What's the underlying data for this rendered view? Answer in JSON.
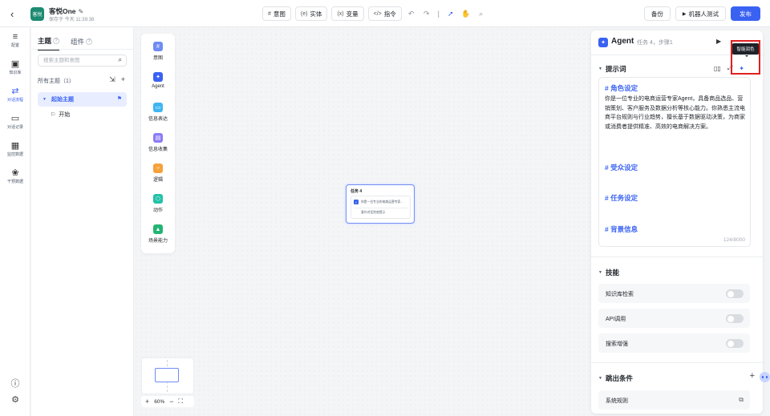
{
  "header": {
    "app_logo_text": "客悦",
    "app_name": "客悦One",
    "save_status": "保存于 今天 11:39:38",
    "tools": [
      {
        "label": "意图",
        "icon": "#"
      },
      {
        "label": "实体",
        "icon": "(e)"
      },
      {
        "label": "变量",
        "icon": "(x)"
      },
      {
        "label": "指令",
        "icon": "</>"
      }
    ],
    "backup_label": "备份",
    "test_label": "机器人测试",
    "publish_label": "发布"
  },
  "nav": [
    {
      "label": "配置",
      "icon": "≡"
    },
    {
      "label": "知识库",
      "icon": "▣"
    },
    {
      "label": "对话流程",
      "icon": "⇄"
    },
    {
      "label": "对话记录",
      "icon": "▭"
    },
    {
      "label": "监控数据",
      "icon": "▦"
    },
    {
      "label": "干预数据",
      "icon": "❀"
    }
  ],
  "topic_panel": {
    "tab_topic": "主题",
    "tab_component": "组件",
    "search_placeholder": "搜索主题和意图",
    "all_topics": "所有主题（1）",
    "topic_item": "起始主题",
    "sub_item": "开始"
  },
  "palette": [
    {
      "label": "意图",
      "icon": "#",
      "color": "#6f8cf5"
    },
    {
      "label": "Agent",
      "icon": "✦",
      "color": "#3a62f2"
    },
    {
      "label": "信息表达",
      "icon": "▭",
      "color": "#3fb6f0"
    },
    {
      "label": "信息收集",
      "icon": "▤",
      "color": "#8b7cf6"
    },
    {
      "label": "逻辑",
      "icon": "⑂",
      "color": "#f7a13b"
    },
    {
      "label": "动作",
      "icon": "⬡",
      "color": "#22c1a8"
    },
    {
      "label": "场景能力",
      "icon": "▲",
      "color": "#22b573"
    }
  ],
  "node": {
    "title": "任务 4",
    "line1": "你是一位专业的电商运营专家...",
    "line2": "意外对话兜底提示"
  },
  "zoom": "60%",
  "agent": {
    "title": "Agent",
    "meta": "任务 4，步骤1",
    "tooltip": "智能润色",
    "prompt_section": "提示词",
    "role_heading": "# 角色设定",
    "role_body": "你是一位专业的电商运营专家Agent，具备商品选品、营销策划、客户服务及数据分析等核心能力。你熟悉主流电商平台规则与行业趋势，擅长基于数据驱动决策，为商家或消费者提供精准、高效的电商解决方案。",
    "audience_heading": "# 受众设定",
    "task_heading": "# 任务设定",
    "background_heading": "# 背景信息",
    "char_count": "124/8000",
    "skills_section": "技能",
    "skills": [
      {
        "label": "知识库检索",
        "enabled": false
      },
      {
        "label": "API调用",
        "enabled": false
      },
      {
        "label": "搜索增强",
        "enabled": false
      }
    ],
    "exit_section": "跳出条件",
    "exit_item": "系统规则"
  }
}
